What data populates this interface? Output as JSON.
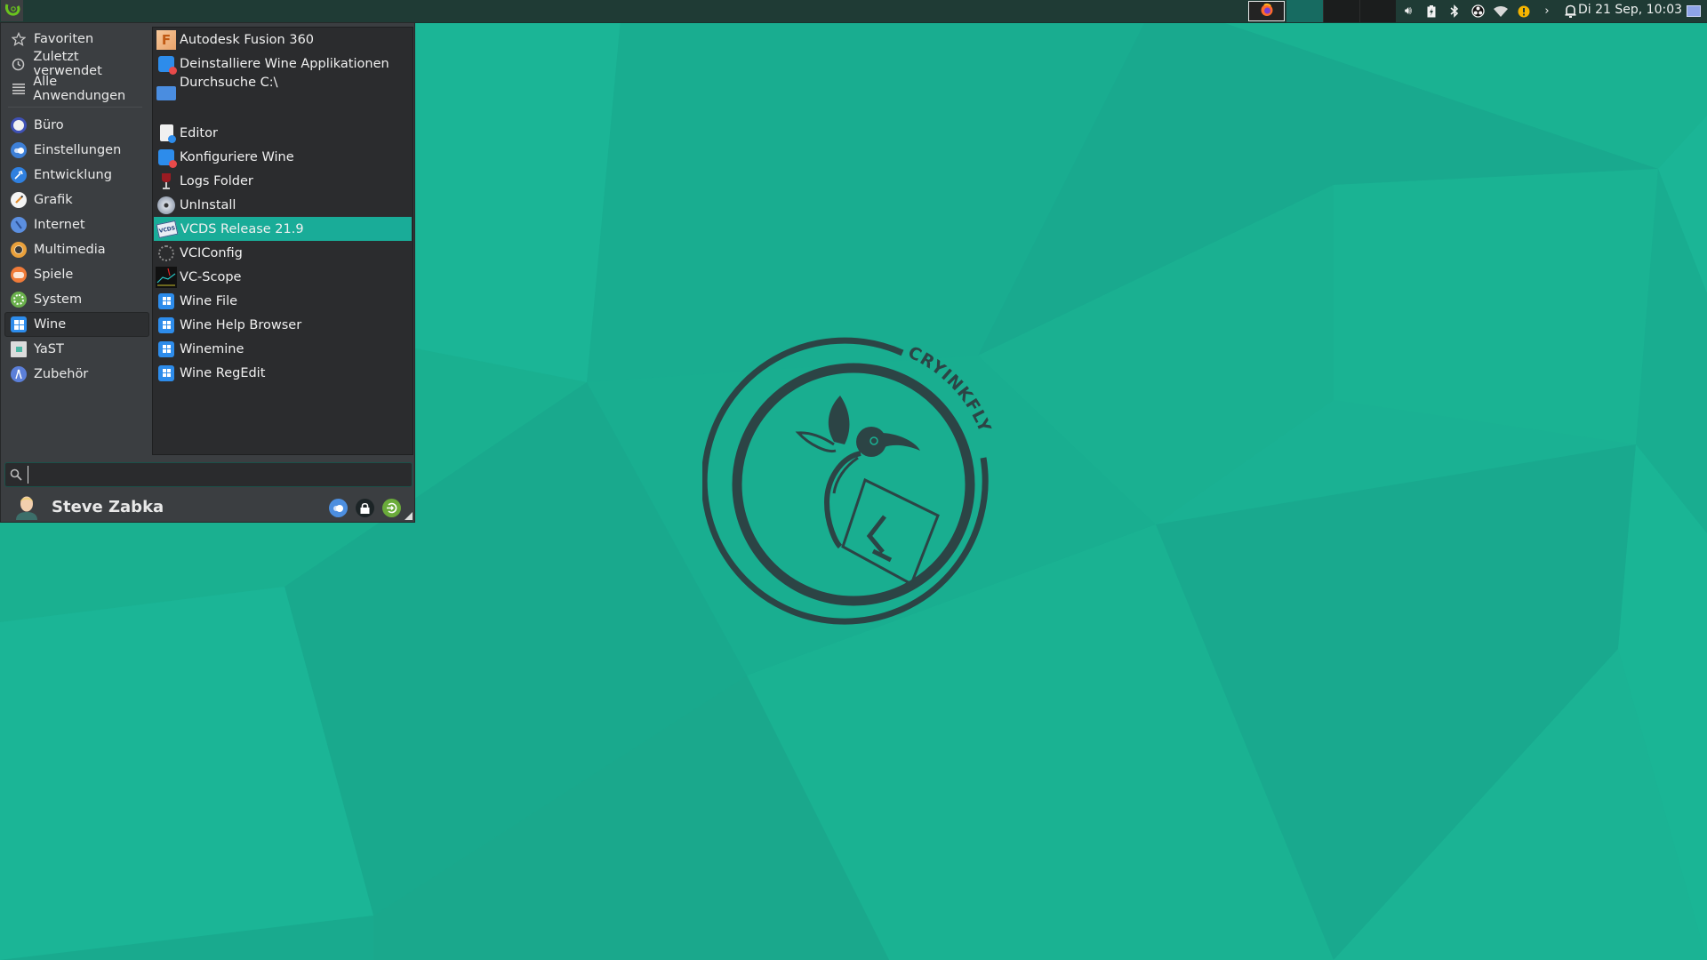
{
  "panel": {
    "menu_button_icon": "opensuse-chameleon-icon",
    "tasks": [
      {
        "icon": "firefox-icon",
        "active": true
      },
      {
        "icon": "",
        "active": false
      },
      {
        "icon": "",
        "active": false
      },
      {
        "icon": "",
        "active": false
      }
    ],
    "tray": [
      "volume-icon",
      "battery-icon",
      "bluetooth-icon",
      "obs-icon",
      "wifi-icon",
      "update-warning-icon",
      "expand-arrow-icon",
      "notification-bell-icon"
    ],
    "clock": "Di 21 Sep, 10:03",
    "show_desktop_icon": "workspace-icon"
  },
  "menu": {
    "categories_top": [
      {
        "label": "Favoriten",
        "icon": "star-icon"
      },
      {
        "label": "Zuletzt verwendet",
        "icon": "clock-icon"
      },
      {
        "label": "Alle Anwendungen",
        "icon": "list-icon"
      }
    ],
    "categories": [
      {
        "label": "Büro",
        "icon": "office-icon",
        "color": "#3f51b5"
      },
      {
        "label": "Einstellungen",
        "icon": "settings-toggle-icon",
        "color": "#3d7fd6"
      },
      {
        "label": "Entwicklung",
        "icon": "development-icon",
        "color": "#2f80e0"
      },
      {
        "label": "Grafik",
        "icon": "graphics-palette-icon",
        "color": "#f4f4f4"
      },
      {
        "label": "Internet",
        "icon": "internet-compass-icon",
        "color": "#5b8fe0"
      },
      {
        "label": "Multimedia",
        "icon": "multimedia-speaker-icon",
        "color": "#e9a03b"
      },
      {
        "label": "Spiele",
        "icon": "games-gamepad-icon",
        "color": "#f07b39"
      },
      {
        "label": "System",
        "icon": "system-gear-icon",
        "color": "#6ab04c"
      },
      {
        "label": "Wine",
        "icon": "wine-windows-icon",
        "color": "#2d8ceb",
        "active": true
      },
      {
        "label": "YaST",
        "icon": "yast-icon",
        "color": "#dcdcdc"
      },
      {
        "label": "Zubehör",
        "icon": "accessories-compass-icon",
        "color": "#5b7fd9"
      }
    ],
    "apps": [
      {
        "label": "Autodesk Fusion 360",
        "icon": "fusion360-icon"
      },
      {
        "label": "Deinstalliere Wine Applikationen",
        "icon": "wine-uninstall-icon"
      },
      {
        "label": "Durchsuche C:\\",
        "icon": "folder-windows-icon"
      },
      {
        "label": "Editor",
        "icon": "text-editor-icon"
      },
      {
        "label": "Konfiguriere Wine",
        "icon": "wine-config-icon"
      },
      {
        "label": "Logs Folder",
        "icon": "wine-glass-icon"
      },
      {
        "label": "UnInstall",
        "icon": "vcds-disc-icon"
      },
      {
        "label": "VCDS Release 21.9",
        "icon": "vcds-x64-icon",
        "highlighted": true
      },
      {
        "label": "VCIConfig",
        "icon": "vci-config-gear-icon"
      },
      {
        "label": "VC-Scope",
        "icon": "vc-scope-icon"
      },
      {
        "label": "Wine File",
        "icon": "wine-windows-icon"
      },
      {
        "label": "Wine Help Browser",
        "icon": "wine-windows-icon"
      },
      {
        "label": "Winemine",
        "icon": "wine-windows-icon"
      },
      {
        "label": "Wine RegEdit",
        "icon": "wine-windows-icon"
      }
    ],
    "search": {
      "value": "",
      "placeholder": ""
    },
    "user": {
      "name": "Steve Zabka"
    },
    "actions": [
      {
        "name": "settings",
        "icon": "settings-toggle-icon"
      },
      {
        "name": "lock",
        "icon": "lock-icon"
      },
      {
        "name": "logout",
        "icon": "logout-icon"
      }
    ]
  },
  "wallpaper": {
    "logo_text": "CRYINKFLY",
    "colors": {
      "base": "#1ab193",
      "dark": "#19a98e",
      "light": "#1bb596",
      "logo": "#2c4445"
    }
  }
}
